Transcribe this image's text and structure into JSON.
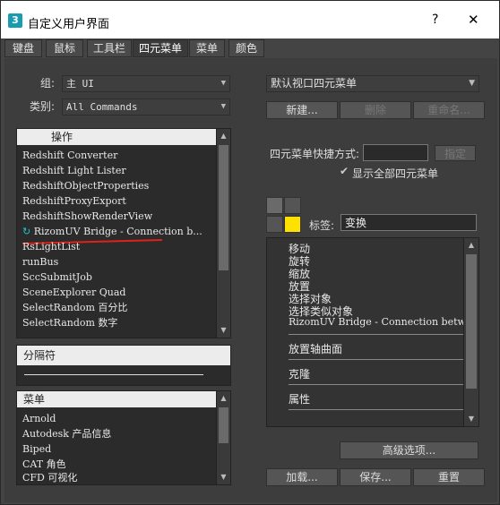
{
  "window": {
    "title": "自定义用户界面",
    "help": "?",
    "close": "✕",
    "app_icon": "3"
  },
  "tabs": [
    "键盘",
    "鼠标",
    "工具栏",
    "四元菜单",
    "菜单",
    "颜色"
  ],
  "left": {
    "group_label": "组:",
    "group_value": "主 UI",
    "category_label": "类别:",
    "category_value": "All Commands",
    "actions_header": "操作",
    "actions": [
      "Redshift Converter",
      "Redshift Light Lister",
      "RedshiftObjectProperties",
      "RedshiftProxyExport",
      "RedshiftShowRenderView",
      "RizomUV Bridge - Connection b...",
      "RsLightList",
      "runBus",
      "SccSubmitJob",
      "SceneExplorer Quad",
      "SelectRandom 百分比",
      "SelectRandom 数字"
    ],
    "separator_label": "分隔符",
    "menus_header": "菜单",
    "menus": [
      "Arnold",
      "Autodesk 产品信息",
      "Biped",
      "CAT 角色",
      "CFD 可视化"
    ]
  },
  "right": {
    "quad_menu_value": "默认视口四元菜单",
    "new_label": "新建...",
    "rename_label": "删除",
    "copy_label": "重命名...",
    "shortcut_label": "四元菜单快捷方式:",
    "shortcut_value": "",
    "assign_label": "指定",
    "show_all_label": "显示全部四元菜单",
    "tag_label": "标签:",
    "tag_value": "变换",
    "items": [
      "移动",
      "旋转",
      "缩放",
      "放置",
      "选择对象",
      "选择类似对象",
      "RizomUV Bridge - Connection betw",
      "放置轴曲面",
      "克隆",
      "属性"
    ]
  },
  "buttons": {
    "advanced": "高级选项...",
    "load": "加载...",
    "save": "保存...",
    "reset": "重置"
  },
  "colors": {
    "accent_yellow": "#ffe100",
    "annotation_red": "#e0201a",
    "icon_teal": "#23c4c8"
  }
}
